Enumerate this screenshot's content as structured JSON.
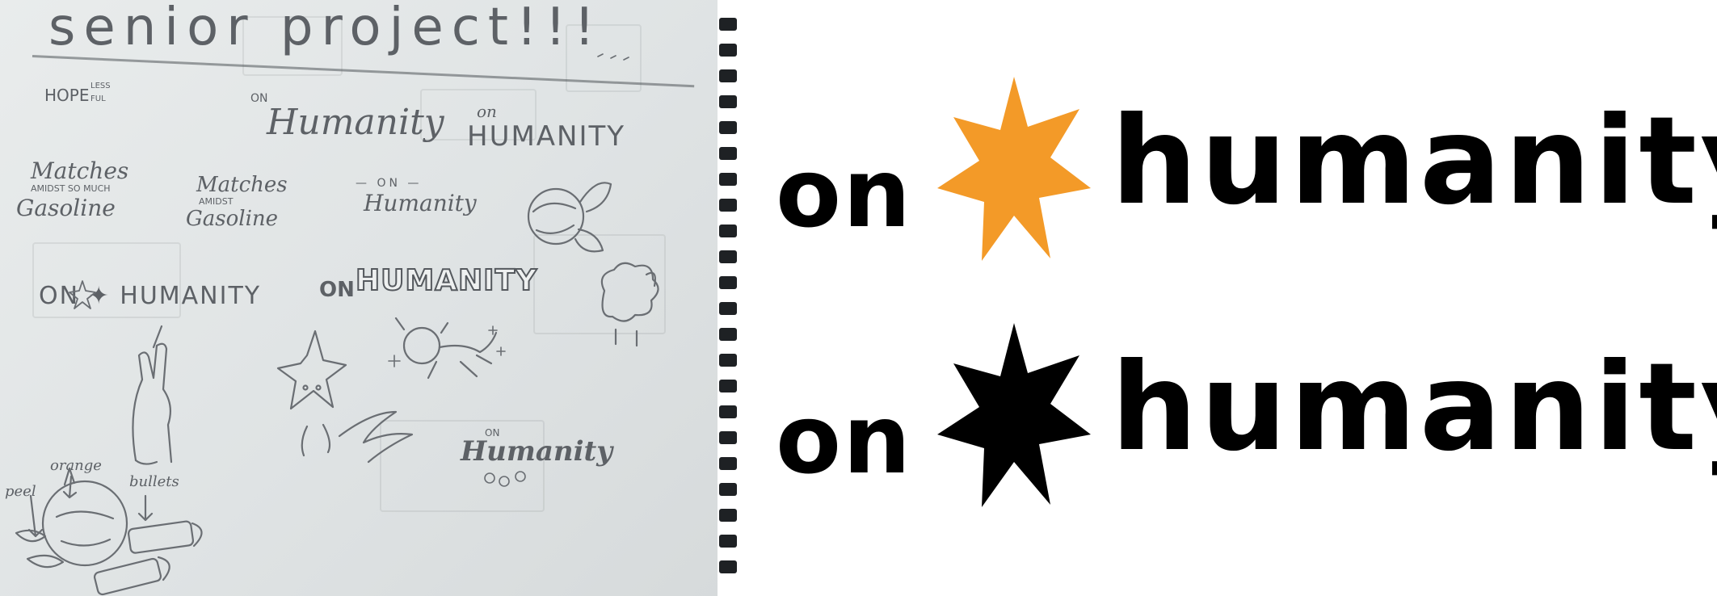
{
  "sketch": {
    "title": "senior project!!!",
    "hope": "HOPE",
    "less": "LESS",
    "ful": "FUL",
    "on_small": "ON",
    "humanity_script": "Humanity",
    "on_small_2": "on",
    "humanity_caps": "HUMANITY",
    "matches_1": "Matches",
    "amidst_so_much": "AMIDST SO MUCH",
    "gasoline_1": "Gasoline",
    "matches_2": "Matches",
    "amidst": "AMIDST",
    "gasoline_2": "Gasoline",
    "on_dash": "— ON —",
    "humanity_small": "Humanity",
    "on_star_humanity": "ON ✦ HUMANITY",
    "on_bubble": "ON",
    "humanity_bubble": "HUMANITY",
    "orange_label": "orange",
    "peel_label": "peel",
    "bullets_label": "bullets",
    "on_tiny": "ON",
    "humanity_final": "Humanity"
  },
  "logos": {
    "on": "on",
    "humanity": "humanity",
    "star_color_orange": "#F39A28",
    "star_color_black": "#000000"
  }
}
